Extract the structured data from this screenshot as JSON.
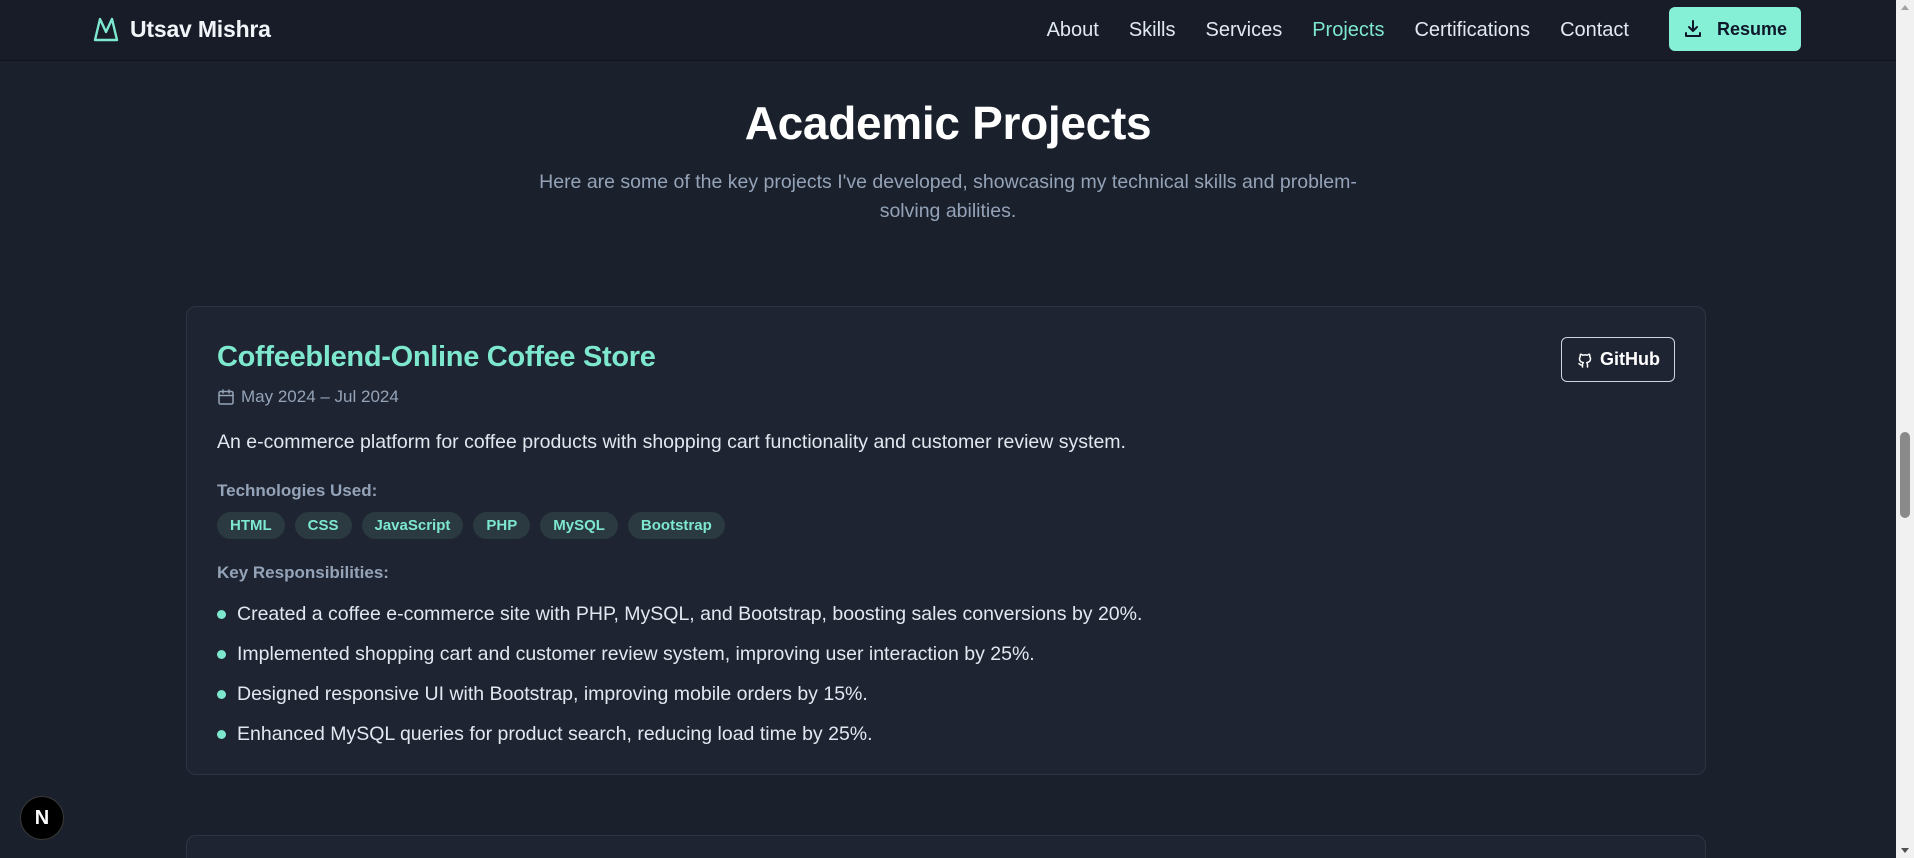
{
  "brand": {
    "name": "Utsav Mishra",
    "icon": "mountain-logo-icon"
  },
  "nav": {
    "links": [
      {
        "label": "About",
        "active": false
      },
      {
        "label": "Skills",
        "active": false
      },
      {
        "label": "Services",
        "active": false
      },
      {
        "label": "Projects",
        "active": true
      },
      {
        "label": "Certifications",
        "active": false
      },
      {
        "label": "Contact",
        "active": false
      }
    ],
    "resume_label": "Resume"
  },
  "section": {
    "title": "Academic Projects",
    "subtitle": "Here are some of the key projects I've developed, showcasing my technical skills and problem-solving abilities."
  },
  "project": {
    "title": "Coffeeblend-Online Coffee Store",
    "date": "May 2024 – Jul 2024",
    "github_label": "GitHub",
    "description": "An e-commerce platform for coffee products with shopping cart functionality and customer review system.",
    "tech_label": "Technologies Used:",
    "technologies": [
      "HTML",
      "CSS",
      "JavaScript",
      "PHP",
      "MySQL",
      "Bootstrap"
    ],
    "resp_label": "Key Responsibilities:",
    "responsibilities": [
      "Created a coffee e-commerce site with PHP, MySQL, and Bootstrap, boosting sales conversions by 20%.",
      "Implemented shopping cart and customer review system, improving user interaction by 25%.",
      "Designed responsive UI with Bootstrap, improving mobile orders by 15%.",
      "Enhanced MySQL queries for product search, reducing load time by 25%."
    ]
  },
  "badge": {
    "letter": "N"
  },
  "colors": {
    "accent": "#7ee8cf",
    "background": "#1a202c",
    "card": "#1e2431",
    "button": "#86f0d6"
  }
}
